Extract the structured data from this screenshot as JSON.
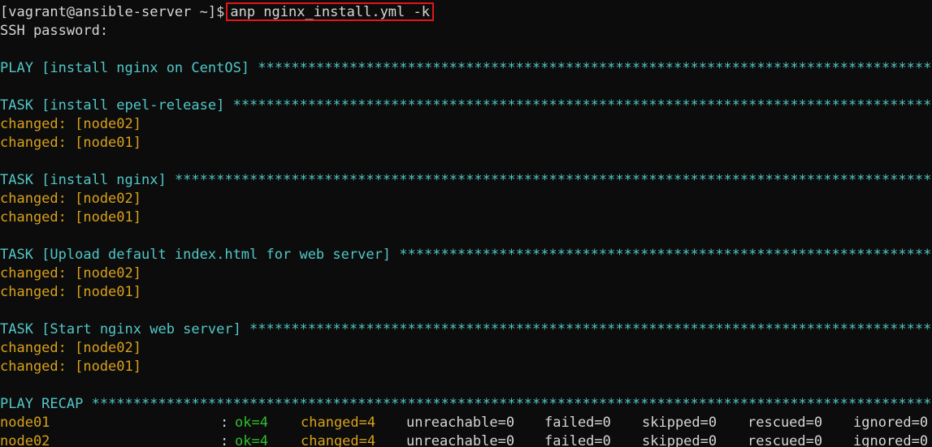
{
  "terminal": {
    "prompt": "[vagrant@ansible-server ~]$",
    "command": "anp nginx_install.yml -k",
    "password_prompt": "SSH password:",
    "play_header": "PLAY [install nginx on CentOS] ",
    "tasks": [
      {
        "header": "TASK [install epel-release] ",
        "results": [
          "changed: [node02]",
          "changed: [node01]"
        ]
      },
      {
        "header": "TASK [install nginx] ",
        "results": [
          "changed: [node02]",
          "changed: [node01]"
        ]
      },
      {
        "header": "TASK [Upload default index.html for web server] ",
        "results": [
          "changed: [node02]",
          "changed: [node01]"
        ]
      },
      {
        "header": "TASK [Start nginx web server] ",
        "results": [
          "changed: [node02]",
          "changed: [node01]"
        ]
      }
    ],
    "recap_header": "PLAY RECAP ",
    "recap": [
      {
        "host": "node01",
        "colon": ":",
        "ok": "ok=4",
        "changed": "changed=4",
        "unreachable": "unreachable=0",
        "failed": "failed=0",
        "skipped": "skipped=0",
        "rescued": "rescued=0",
        "ignored": "ignored=0"
      },
      {
        "host": "node02",
        "colon": ":",
        "ok": "ok=4",
        "changed": "changed=4",
        "unreachable": "unreachable=0",
        "failed": "failed=0",
        "skipped": "skipped=0",
        "rescued": "rescued=0",
        "ignored": "ignored=0"
      }
    ],
    "colors": {
      "background": "#0c0c0c",
      "header": "#52c7c7",
      "changed": "#d9a11a",
      "ok": "#2fbf2f",
      "highlight_box": "#e0161b"
    }
  }
}
